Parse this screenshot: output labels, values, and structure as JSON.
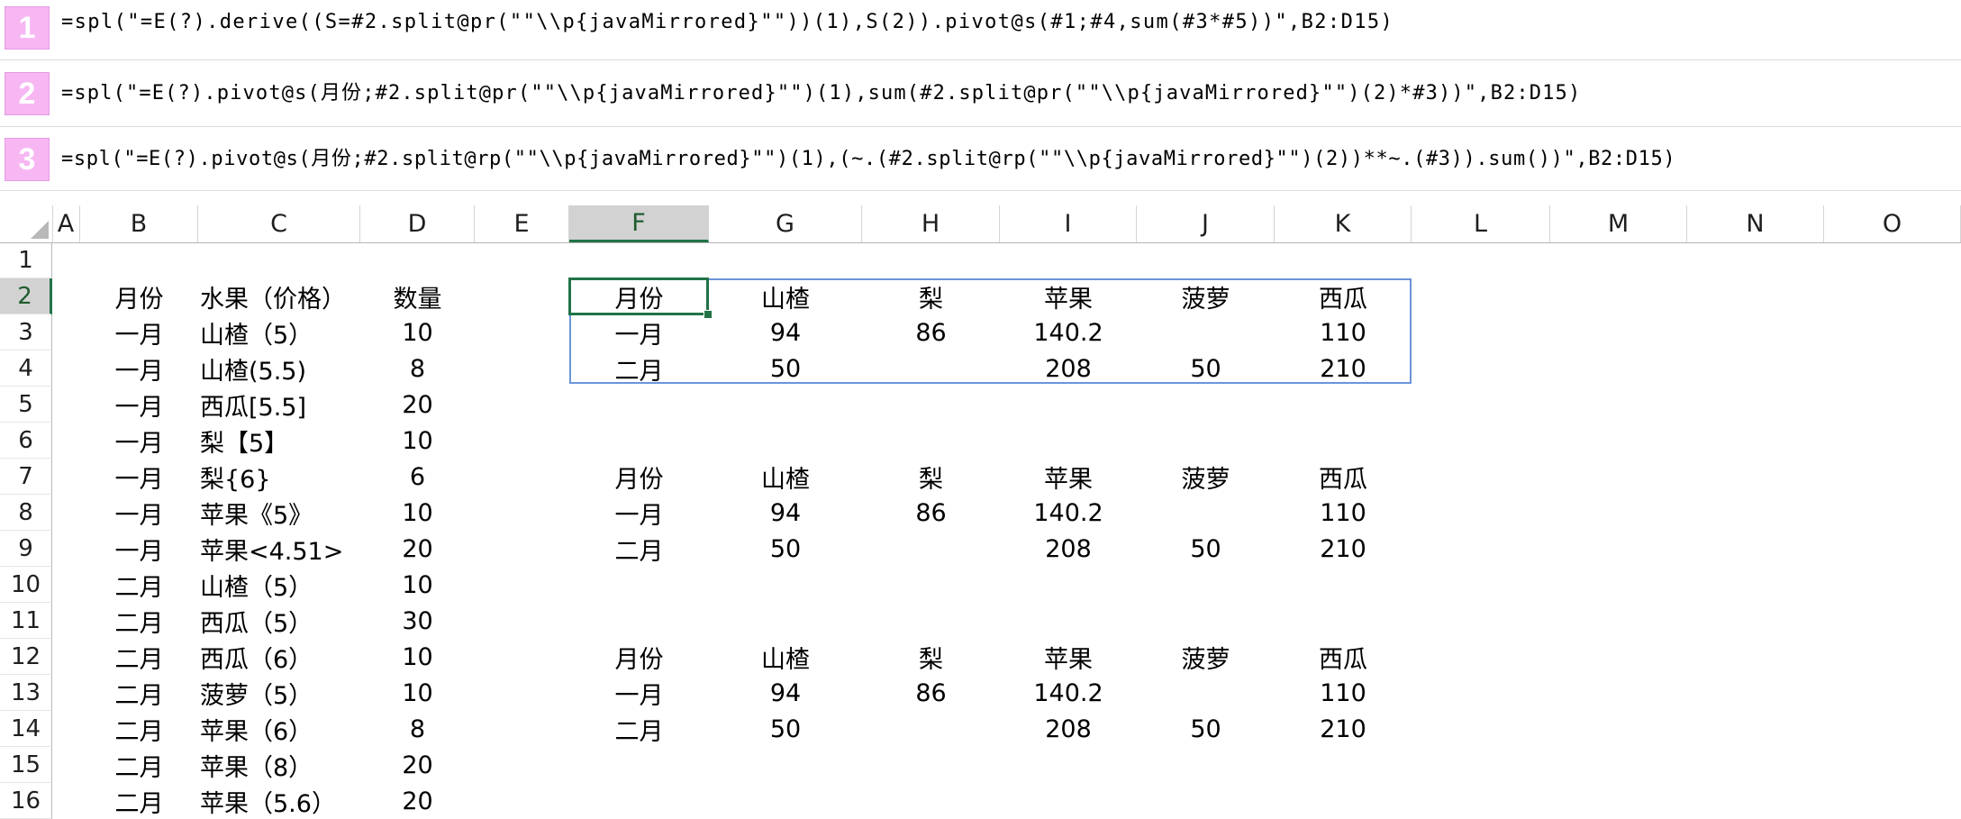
{
  "formulas": [
    {
      "number": "1",
      "text": "=spl(\"=E(?).derive((S=#2.split@pr(\"\"\\\\p{javaMirrored}\"\"))(1),S(2)).pivot@s(#1;#4,sum(#3*#5))\",B2:D15)"
    },
    {
      "number": "2",
      "text": "=spl(\"=E(?).pivot@s(月份;#2.split@pr(\"\"\\\\p{javaMirrored}\"\")(1),sum(#2.split@pr(\"\"\\\\p{javaMirrored}\"\")(2)*#3))\",B2:D15)"
    },
    {
      "number": "3",
      "text": "=spl(\"=E(?).pivot@s(月份;#2.split@rp(\"\"\\\\p{javaMirrored}\"\")(1),(~.(#2.split@rp(\"\"\\\\p{javaMirrored}\"\")(2))**~.(#3)).sum())\",B2:D15)"
    }
  ],
  "columns": [
    "A",
    "B",
    "C",
    "D",
    "E",
    "F",
    "G",
    "H",
    "I",
    "J",
    "K",
    "L",
    "M",
    "N",
    "O"
  ],
  "selected_column": "F",
  "rows": [
    "1",
    "2",
    "3",
    "4",
    "5",
    "6",
    "7",
    "8",
    "9",
    "10",
    "11",
    "12",
    "13",
    "14",
    "15",
    "16"
  ],
  "selected_row": "2",
  "source_table": {
    "headers": [
      "月份",
      "水果（价格）",
      "数量"
    ],
    "rows": [
      [
        "一月",
        "山楂（5）",
        "10"
      ],
      [
        "一月",
        "山楂(5.5)",
        "8"
      ],
      [
        "一月",
        "西瓜[5.5]",
        "20"
      ],
      [
        "一月",
        "梨【5】",
        "10"
      ],
      [
        "一月",
        "梨{6}",
        "6"
      ],
      [
        "一月",
        "苹果《5》",
        "10"
      ],
      [
        "一月",
        "苹果<4.51>",
        "20"
      ],
      [
        "二月",
        "山楂（5）",
        "10"
      ],
      [
        "二月",
        "西瓜（5）",
        "30"
      ],
      [
        "二月",
        "西瓜（6）",
        "10"
      ],
      [
        "二月",
        "菠萝（5）",
        "10"
      ],
      [
        "二月",
        "苹果（6）",
        "8"
      ],
      [
        "二月",
        "苹果（8）",
        "20"
      ],
      [
        "二月",
        "苹果（5.6）",
        "20"
      ]
    ]
  },
  "result_tables": [
    {
      "headers": [
        "月份",
        "山楂",
        "梨",
        "苹果",
        "菠萝",
        "西瓜"
      ],
      "rows": [
        [
          "一月",
          "94",
          "86",
          "140.2",
          "",
          "110"
        ],
        [
          "二月",
          "50",
          "",
          "208",
          "50",
          "210"
        ]
      ]
    },
    {
      "headers": [
        "月份",
        "山楂",
        "梨",
        "苹果",
        "菠萝",
        "西瓜"
      ],
      "rows": [
        [
          "一月",
          "94",
          "86",
          "140.2",
          "",
          "110"
        ],
        [
          "二月",
          "50",
          "",
          "208",
          "50",
          "210"
        ]
      ]
    },
    {
      "headers": [
        "月份",
        "山楂",
        "梨",
        "苹果",
        "菠萝",
        "西瓜"
      ],
      "rows": [
        [
          "一月",
          "94",
          "86",
          "140.2",
          "",
          "110"
        ],
        [
          "二月",
          "50",
          "",
          "208",
          "50",
          "210"
        ]
      ]
    }
  ],
  "colors": {
    "badge_fill": "#f7b7f3",
    "selection_green": "#217346",
    "table_border_blue": "#6b95d8"
  }
}
